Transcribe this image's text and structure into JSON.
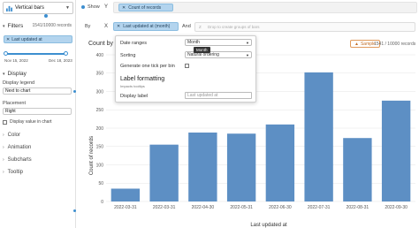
{
  "sidebar": {
    "chart_type": "Vertical bars",
    "filters_label": "Filters",
    "records": "1541/10000 records",
    "filter_chip": "Last updated at",
    "slider_from": "Nov 15, 2022",
    "slider_to": "Dec 18, 2023",
    "display_label": "Display",
    "display_legend_label": "Display legend",
    "display_legend_value": "Next to chart",
    "placement_label": "Placement",
    "placement_value": "Right",
    "display_value_label": "Display value in chart",
    "sections": [
      "Color",
      "Animation",
      "Subcharts",
      "Tooltip"
    ]
  },
  "shelves": {
    "show_label": "Show",
    "by_label": "By",
    "y_letter": "Y",
    "x_letter": "X",
    "y_pill": "Count of records",
    "x_pill": "Last updated at (month)",
    "and_label": "And",
    "z_letter": "Z",
    "z_placeholder": "Drop to create groups of bars"
  },
  "chart": {
    "title": "Count by L",
    "sample_label": "Sample",
    "records": "1541 / 10000 records"
  },
  "overlay": {
    "date_ranges_label": "Date ranges",
    "date_ranges_value": "Month",
    "sorting_label": "Sorting",
    "sorting_value": "Natural ordering",
    "one_tick_label": "Generate one tick per bin",
    "label_formatting": "Label formatting",
    "impacts_tooltips": "Impacts tooltips",
    "display_label_label": "Display label",
    "display_label_placeholder": "Last updated at",
    "tooltip": "Month"
  },
  "chart_data": {
    "type": "bar",
    "title": "",
    "xlabel": "Last updated at",
    "ylabel": "Count of records",
    "ylim": [
      0,
      400
    ],
    "yticks": [
      0,
      50,
      100,
      150,
      200,
      250,
      300,
      350,
      400
    ],
    "categories": [
      "2022-03-31",
      "2022-03-31",
      "2022-04-30",
      "2022-05-31",
      "2022-06-30",
      "2022-07-31",
      "2022-08-31",
      "2022-09-30"
    ],
    "values": [
      35,
      155,
      188,
      185,
      210,
      352,
      173,
      275
    ],
    "bar_color": "#5d8fc4"
  }
}
